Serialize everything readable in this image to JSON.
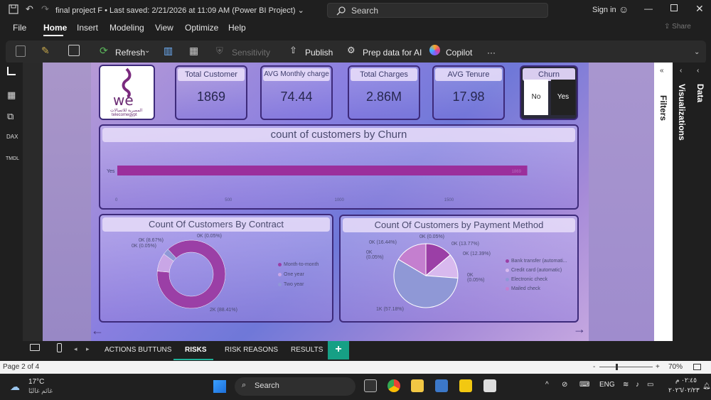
{
  "window": {
    "title": "final project F",
    "saved": "• Last saved: 2/21/2026 at 11:09 AM (Power BI Project)",
    "search_label": "Search",
    "signin_label": "Sign in"
  },
  "menu": [
    "File",
    "Home",
    "Insert",
    "Modeling",
    "View",
    "Optimize",
    "Help"
  ],
  "share_label": "Share",
  "ribbon": {
    "refresh": "Refresh",
    "sensitivity": "Sensitivity",
    "publish": "Publish",
    "prep_ai": "Prep data for AI",
    "copilot": "Copilot",
    "more": "···"
  },
  "kpis": [
    {
      "title": "Total Customer",
      "value": "1869"
    },
    {
      "title": "AVG Monthly charge",
      "value": "74.44"
    },
    {
      "title": "Total Charges",
      "value": "2.86M"
    },
    {
      "title": "AVG Tenure",
      "value": "17.98"
    }
  ],
  "logo": {
    "text": "we",
    "subtitle_ar": "المصرية للاتصالات",
    "subtitle_en": "telecomegypt"
  },
  "slicer": {
    "title": "Churn",
    "options": [
      "No",
      "Yes"
    ],
    "selected": "Yes"
  },
  "churn_chart": {
    "title": "count of customers by Churn",
    "category": "Yes",
    "value_label": "1869",
    "ticks": [
      "0",
      "500",
      "1000",
      "1500"
    ]
  },
  "chart_data": [
    {
      "type": "bar",
      "title": "count of customers by Churn",
      "categories": [
        "Yes"
      ],
      "values": [
        1869
      ],
      "xlim": [
        0,
        2000
      ]
    },
    {
      "type": "pie",
      "title": "Count Of Customers By Contract",
      "labels": [
        "Month-to-month",
        "One year",
        "Two year"
      ],
      "values": [
        88.41,
        8.67,
        2.92
      ],
      "colors": [
        "#9b3fa6",
        "#c9a6e6",
        "#8f98d6"
      ],
      "data_labels": [
        "2K (88.41%)",
        "0K (8.67%)",
        "0K (0.05%)",
        "0K (0.05%)"
      ]
    },
    {
      "type": "pie",
      "title": "Count Of Customers by Payment Method",
      "labels": [
        "Bank transfer (automati...",
        "Credit card (automatic)",
        "Electronic check",
        "Mailed check"
      ],
      "values": [
        13.77,
        12.39,
        57.18,
        16.44
      ],
      "colors": [
        "#9b3fa6",
        "#d8b9ee",
        "#8f98d6",
        "#c47fcf"
      ],
      "data_labels": [
        "0K (0.05%)",
        "0K (13.77%)",
        "0K (12.39%)",
        "0K (0.05%)",
        "1K (57.18%)",
        "0K (0.05%)",
        "0K (16.44%)"
      ]
    }
  ],
  "pane": {
    "filters": "Filters",
    "visualizations": "Visualizations",
    "data": "Data"
  },
  "page_tabs": [
    "ACTIONS BUTTUNS",
    "RISKS",
    "RISK REASONS",
    "RESULTS"
  ],
  "active_tab": "RISKS",
  "status": {
    "page": "Page 2 of 4",
    "zoom": "70%"
  },
  "taskbar": {
    "temp": "17°C",
    "weather_ar": "غائم غالبًا",
    "search": "Search",
    "lang": "ENG",
    "time": "٠٢:٤٥ م",
    "date": "٢٠٢٦/٠٢/٢٣"
  }
}
